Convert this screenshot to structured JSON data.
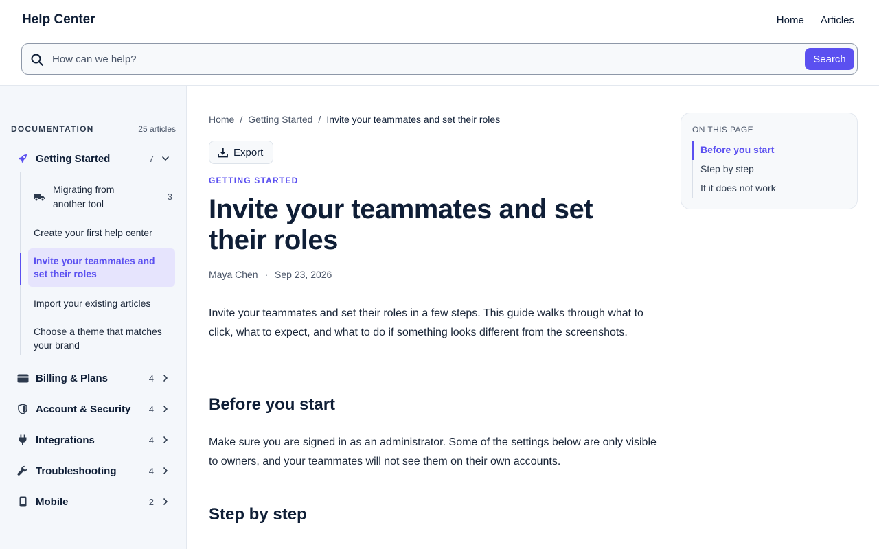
{
  "header": {
    "brand": "Help Center",
    "nav": [
      "Home",
      "Articles"
    ]
  },
  "search": {
    "placeholder": "How can we help?",
    "button_label": "Search",
    "icon": "search-icon"
  },
  "sidebar": {
    "title": "DOCUMENTATION",
    "count": "25 articles",
    "categories": [
      {
        "label": "Getting Started",
        "count": "7",
        "icon": "rocket-icon",
        "expanded": true
      },
      {
        "label": "Billing & Plans",
        "count": "4",
        "icon": "credit-card-icon"
      },
      {
        "label": "Account & Security",
        "count": "4",
        "icon": "shield-icon"
      },
      {
        "label": "Integrations",
        "count": "4",
        "icon": "plug-icon"
      },
      {
        "label": "Troubleshooting",
        "count": "4",
        "icon": "wrench-icon"
      },
      {
        "label": "Mobile",
        "count": "2",
        "icon": "phone-icon"
      }
    ],
    "getting_started_items": {
      "migrating": {
        "label": "Migrating from another tool",
        "count": "3",
        "icon": "truck-icon"
      },
      "items": [
        "Create your first help center",
        "Invite your teammates and set their roles",
        "Import your existing articles",
        "Choose a theme that matches your brand"
      ],
      "active": "Invite your teammates and set their roles"
    }
  },
  "article": {
    "breadcrumb": [
      "Home",
      "Getting Started",
      "Invite your teammates and set their roles"
    ],
    "export_label": "Export",
    "eyebrow": "GETTING STARTED",
    "title": "Invite your teammates and set their roles",
    "author": "Maya Chen",
    "date": "Sep 23, 2026",
    "intro": "Invite your teammates and set their roles in a few steps. This guide walks through what to click, what to expect, and what to do if something looks different from the screenshots.",
    "sections": [
      {
        "heading": "Before you start",
        "body": "Make sure you are signed in as an administrator. Some of the settings below are only visible to owners, and your teammates will not see them on their own accounts."
      },
      {
        "heading": "Step by step"
      }
    ]
  },
  "toc": {
    "title": "ON THIS PAGE",
    "items": [
      "Before you start",
      "Step by step",
      "If it does not work"
    ],
    "active": "Before you start"
  },
  "colors": {
    "accent": "#5b50f0",
    "active_bg": "#e6e4fd",
    "sidebar_bg": "#f4f7fb",
    "text": "#0f1e36"
  }
}
